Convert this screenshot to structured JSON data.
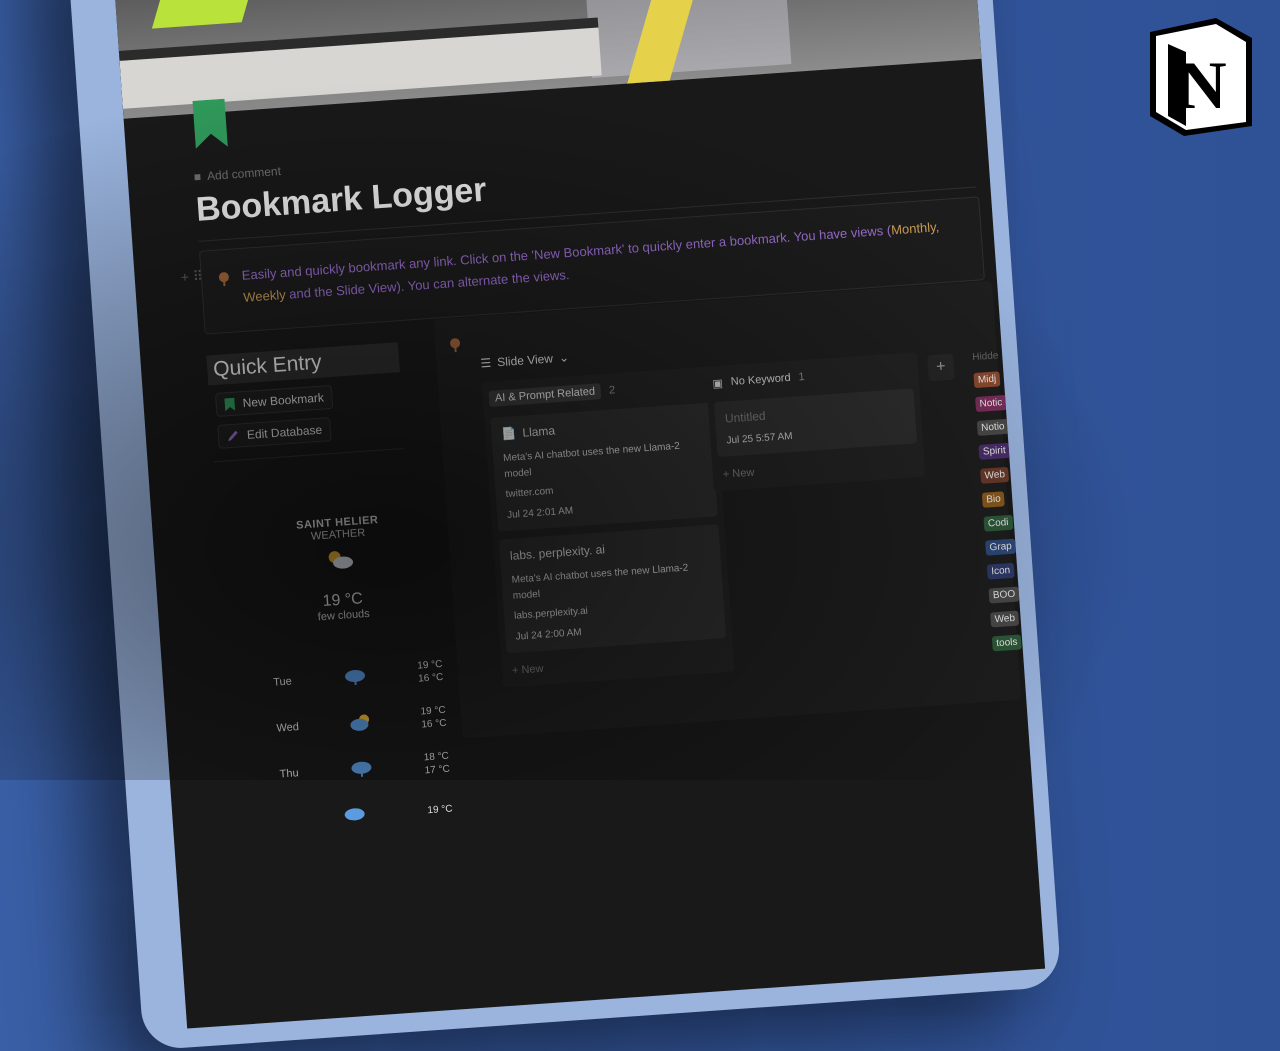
{
  "page": {
    "add_comment": "Add comment",
    "title": "Bookmark Logger",
    "callout_text_a": "Easily and quickly bookmark any link. Click on the 'New Bookmark' to quickly enter a bookmark. You have  views (",
    "callout_text_highlight": "Monthly, Weekly",
    "callout_text_b": " and the Slide View). You can alternate the views."
  },
  "quick_entry": {
    "title": "Quick Entry",
    "new_bookmark": "New Bookmark",
    "edit_database": "Edit Database"
  },
  "weather": {
    "city": "SAINT HELIER",
    "subtitle": "WEATHER",
    "temp": "19 °C",
    "desc": "few clouds",
    "forecast": [
      {
        "day": "Tue",
        "high": "19 °C",
        "low": "16 °C"
      },
      {
        "day": "Wed",
        "high": "19 °C",
        "low": "16 °C"
      },
      {
        "day": "Thu",
        "high": "18 °C",
        "low": "17 °C"
      },
      {
        "day": "",
        "high": "19 °C",
        "low": ""
      }
    ]
  },
  "board": {
    "view_name": "Slide View",
    "columns": [
      {
        "name": "AI & Prompt Related",
        "count": "2",
        "cards": [
          {
            "title": "Llama",
            "desc": "Meta's AI chatbot uses the new Llama-2 model",
            "url": "twitter.com",
            "date": "Jul 24 2:01 AM"
          },
          {
            "title": "labs. perplexity. ai",
            "desc": "Meta's AI chatbot uses the new Llama-2 model",
            "url": "labs.perplexity.ai",
            "date": "Jul 24 2:00 AM"
          }
        ],
        "new_label": "+ New"
      },
      {
        "name": "No Keyword",
        "count": "1",
        "cards": [
          {
            "title": "Untitled",
            "date": "Jul 25 5:57 AM"
          }
        ],
        "new_label": "+ New"
      }
    ],
    "hidden_header": "Hidde",
    "hidden_groups": [
      {
        "label": "Midj",
        "color": "#8a4a2e"
      },
      {
        "label": "Notic",
        "color": "#7a2e5a"
      },
      {
        "label": "Notio",
        "color": "#4a4a4a"
      },
      {
        "label": "Spirit",
        "color": "#4a2e6a"
      },
      {
        "label": "Web",
        "color": "#6a3a2a"
      },
      {
        "label": "Bio",
        "color": "#8a5a1e"
      },
      {
        "label": "Codi",
        "color": "#2e5a3a"
      },
      {
        "label": "Grap",
        "color": "#2e4a7a"
      },
      {
        "label": "Icon",
        "color": "#2e3a6a"
      },
      {
        "label": "BOO",
        "color": "#4a4a4a"
      },
      {
        "label": "Web",
        "color": "#4a4a4a"
      },
      {
        "label": "tools",
        "color": "#2e5a3a"
      }
    ]
  },
  "brand": {
    "logo_letter": "N"
  }
}
